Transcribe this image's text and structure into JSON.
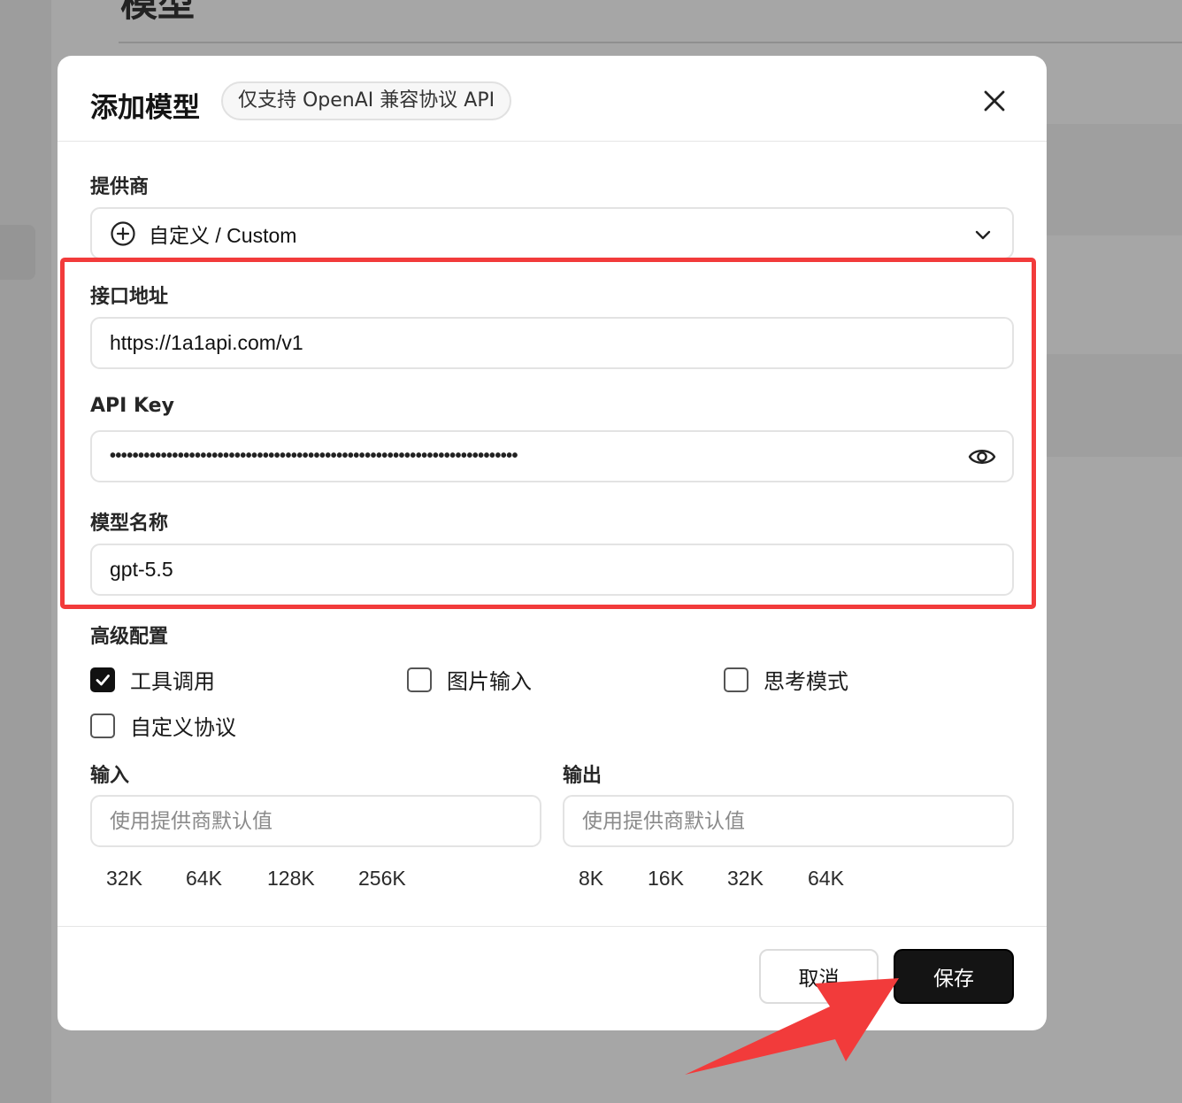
{
  "background": {
    "page_title": "模型"
  },
  "dialog": {
    "title": "添加模型",
    "badge": "仅支持 OpenAI 兼容协议 API",
    "close_icon": "close-icon"
  },
  "provider": {
    "label": "提供商",
    "value": "自定义 / Custom",
    "icon": "plus-circle-icon"
  },
  "endpoint": {
    "label": "接口地址",
    "value": "https://1a1api.com/v1"
  },
  "api_key": {
    "label": "API Key",
    "masked_value": "••••••••••••••••••••••••••••••••••••••••••••••••••••••••••••••••••••••••",
    "toggle_icon": "eye-icon"
  },
  "model_name": {
    "label": "模型名称",
    "value": "gpt-5.5"
  },
  "advanced": {
    "label": "高级配置",
    "options": [
      {
        "label": "工具调用",
        "checked": true
      },
      {
        "label": "图片输入",
        "checked": false
      },
      {
        "label": "思考模式",
        "checked": false
      },
      {
        "label": "自定义协议",
        "checked": false
      }
    ]
  },
  "input_context": {
    "label": "输入",
    "placeholder": "使用提供商默认值",
    "presets": [
      "32K",
      "64K",
      "128K",
      "256K"
    ]
  },
  "output_context": {
    "label": "输出",
    "placeholder": "使用提供商默认值",
    "presets": [
      "8K",
      "16K",
      "32K",
      "64K"
    ]
  },
  "footer": {
    "cancel_label": "取消",
    "save_label": "保存"
  },
  "annotation": {
    "highlight_color": "#f23b3b",
    "arrow_color": "#f23b3b",
    "arrow_icon": "pointer-arrow-icon"
  }
}
